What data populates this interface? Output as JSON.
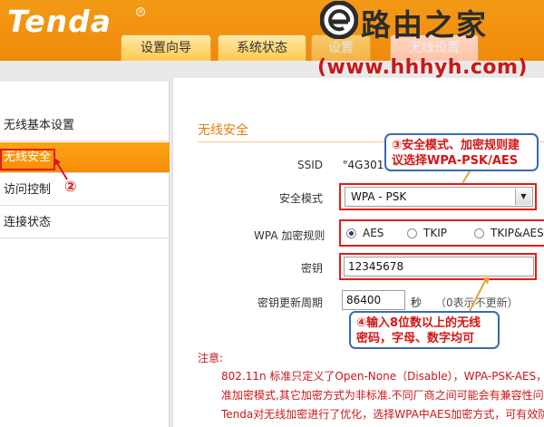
{
  "header": {
    "logo": "Tenda",
    "logo_mark": "®",
    "tabs": [
      {
        "label": "设置向导"
      },
      {
        "label": "系统状态"
      },
      {
        "label": "设置"
      },
      {
        "label": "无线设置"
      }
    ]
  },
  "watermark": {
    "title": "路由之家",
    "url": "(www.hhhyh.com)"
  },
  "sidebar": {
    "items": [
      {
        "label": "无线基本设置"
      },
      {
        "label": "无线安全"
      },
      {
        "label": "访问控制"
      },
      {
        "label": "连接状态"
      }
    ],
    "step_marker": "②"
  },
  "main": {
    "title": "无线安全",
    "ssid_label": "SSID",
    "ssid_value": "\"4G301\"",
    "security_mode_label": "安全模式",
    "security_mode_value": "WPA - PSK",
    "wpa_rule_label": "WPA 加密规则",
    "wpa_options": [
      {
        "label": "AES",
        "selected": true
      },
      {
        "label": "TKIP",
        "selected": false
      },
      {
        "label": "TKIP&AES",
        "selected": false
      }
    ],
    "key_label": "密钥",
    "key_value": "12345678",
    "renew_label": "密钥更新周期",
    "renew_value": "86400",
    "renew_unit": "秒",
    "renew_hint": "（0表示不更新）"
  },
  "callouts": {
    "step3_line1": "③安全模式、加密规则建",
    "step3_line2": "议选择WPA-PSK/AES",
    "step4_line1": "④输入8位数以上的无线",
    "step4_line2": "密码，字母、数字均可"
  },
  "note": {
    "title": "注意:",
    "line1": "802.11n 标准只定义了Open-None（Disable），WPA-PSK-AES，W",
    "line2": "准加密模式,其它加密方式为非标准.不同厂商之间可能会有兼容性问题",
    "line3": "Tenda对无线加密进行了优化，选择WPA中AES加密方式，可有效防"
  },
  "colors": {
    "brand_orange": "#f08a0b",
    "highlight_red": "#e31b1b",
    "callout_border": "#3a69b5",
    "note_red": "#c9171c"
  }
}
